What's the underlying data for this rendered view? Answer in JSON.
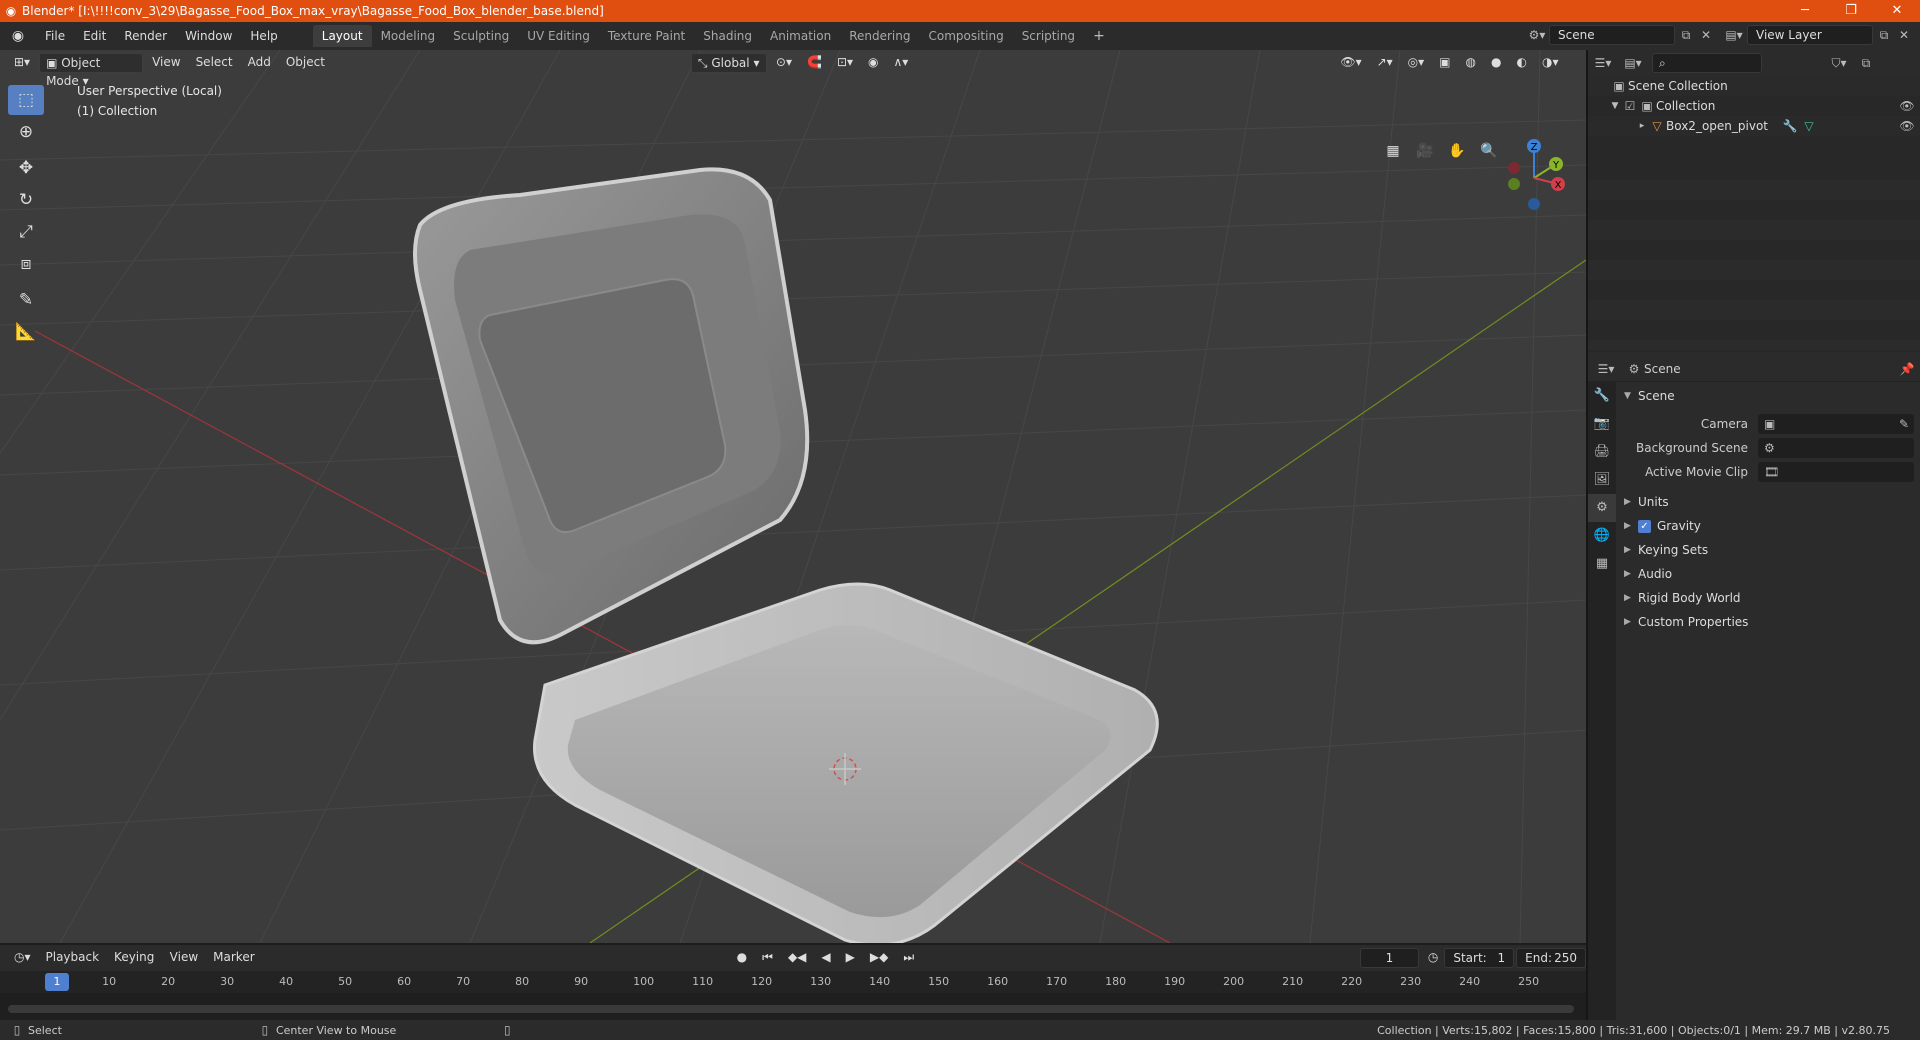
{
  "window": {
    "title": "Blender* [I:\\!!!!conv_3\\29\\Bagasse_Food_Box_max_vray\\Bagasse_Food_Box_blender_base.blend]",
    "controls": [
      "─",
      "❐",
      "✕"
    ]
  },
  "menu": [
    "File",
    "Edit",
    "Render",
    "Window",
    "Help"
  ],
  "workspaces": [
    {
      "label": "Layout",
      "active": true
    },
    {
      "label": "Modeling"
    },
    {
      "label": "Sculpting"
    },
    {
      "label": "UV Editing"
    },
    {
      "label": "Texture Paint"
    },
    {
      "label": "Shading"
    },
    {
      "label": "Animation"
    },
    {
      "label": "Rendering"
    },
    {
      "label": "Compositing"
    },
    {
      "label": "Scripting"
    }
  ],
  "scene_selector": {
    "scene": "Scene",
    "view_layer": "View Layer"
  },
  "viewport": {
    "mode": "Object Mode",
    "menus": [
      "View",
      "Select",
      "Add",
      "Object"
    ],
    "orientation": "Global",
    "perspective_label": "User Perspective (Local)",
    "collection_label": "(1) Collection",
    "gizmo": {
      "z": "Z",
      "y": "Y",
      "x": "X"
    },
    "colors": {
      "bg": "#3c3c3c",
      "grid": "#484848",
      "x_axis": "#a1343d",
      "y_axis": "#6f8f1e",
      "accent": "#5680c2"
    }
  },
  "outliner": {
    "search_placeholder": "",
    "root": "Scene Collection",
    "collection": "Collection",
    "object": "Box2_open_pivot"
  },
  "properties": {
    "header": "Scene",
    "section": "Scene",
    "fields": [
      {
        "label": "Camera"
      },
      {
        "label": "Background Scene"
      },
      {
        "label": "Active Movie Clip"
      }
    ],
    "panels": [
      "Units",
      "Gravity",
      "Keying Sets",
      "Audio",
      "Rigid Body World",
      "Custom Properties"
    ]
  },
  "timeline": {
    "menus": [
      "Playback",
      "Keying",
      "View",
      "Marker"
    ],
    "current_frame": "1",
    "start_label": "Start:",
    "start": "1",
    "end_label": "End:",
    "end": "250",
    "ticks": [
      "1",
      "10",
      "20",
      "30",
      "40",
      "50",
      "60",
      "70",
      "80",
      "90",
      "100",
      "110",
      "120",
      "130",
      "140",
      "150",
      "160",
      "170",
      "180",
      "190",
      "200",
      "210",
      "220",
      "230",
      "240",
      "250"
    ]
  },
  "status": {
    "left": "Select",
    "middle": "Center View to Mouse",
    "right": "Collection | Verts:15,802 | Faces:15,800 | Tris:31,600 | Objects:0/1 | Mem: 29.7 MB | v2.80.75"
  }
}
